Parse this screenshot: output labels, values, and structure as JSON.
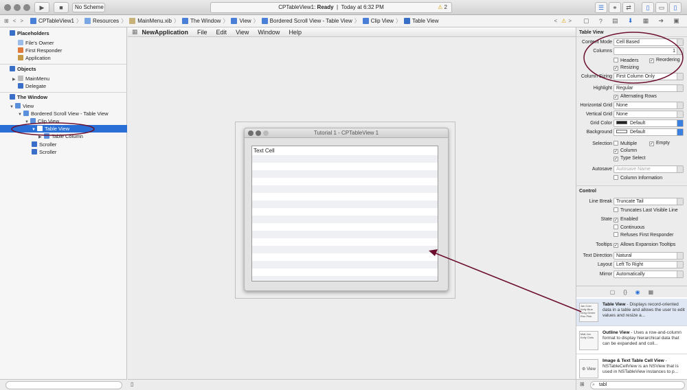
{
  "window": {
    "scheme": "No Scheme"
  },
  "activity": {
    "project": "CPTableView1",
    "state": "Ready",
    "time": "Today at 6:32 PM",
    "warnings": "2"
  },
  "jumpbar": {
    "crumbs": [
      "CPTableView1",
      "Resources",
      "MainMenu.xib",
      "The Window",
      "View",
      "Bordered Scroll View - Table View",
      "Clip View",
      "Table View"
    ]
  },
  "navigator": {
    "placeholders": "Placeholders",
    "files_owner": "File's Owner",
    "first_responder": "First Responder",
    "application": "Application",
    "objects": "Objects",
    "main_menu": "MainMenu",
    "delegate": "Delegate",
    "the_window": "The Window",
    "view": "View",
    "bordered_scroll": "Bordered Scroll View - Table View",
    "clip_view": "Clip View",
    "table_view": "Table View",
    "table_column": "Table Column",
    "scroller1": "Scroller",
    "scroller2": "Scroller"
  },
  "menubar": {
    "app": "NewApplication",
    "file": "File",
    "edit": "Edit",
    "view": "View",
    "window": "Window",
    "help": "Help"
  },
  "designwin": {
    "title": "Tutorial 1 - CPTableView 1",
    "cell": "Text Cell"
  },
  "inspector": {
    "section_table": "Table View",
    "content_mode_label": "Content Mode",
    "content_mode": "Cell Based",
    "columns_label": "Columns",
    "columns": "1",
    "headers": "Headers",
    "reordering": "Reordering",
    "resizing": "Resizing",
    "column_sizing_label": "Column Sizing",
    "column_sizing": "First Column Only",
    "highlight_label": "Highlight",
    "highlight": "Regular",
    "alternating": "Alternating Rows",
    "hgrid_label": "Horizontal Grid",
    "hgrid": "None",
    "vgrid_label": "Vertical Grid",
    "vgrid": "None",
    "grid_color_label": "Grid Color",
    "grid_color": "Default",
    "background_label": "Background",
    "background": "Default",
    "selection_label": "Selection",
    "multiple": "Multiple",
    "empty": "Empty",
    "column": "Column",
    "type_select": "Type Select",
    "autosave_label": "Autosave",
    "autosave_placeholder": "Autosave Name",
    "column_info": "Column Information",
    "section_control": "Control",
    "line_break_label": "Line Break",
    "line_break": "Truncate Tail",
    "truncates": "Truncates Last Visible Line",
    "state_label": "State",
    "enabled": "Enabled",
    "continuous": "Continuous",
    "refuses": "Refuses First Responder",
    "tooltips_label": "Tooltips",
    "tooltips": "Allows Expansion Tooltips",
    "text_dir_label": "Text Direction",
    "text_dir": "Natural",
    "layout_label": "Layout",
    "layout": "Left To Right",
    "mirror_label": "Mirror",
    "mirror": "Automatically"
  },
  "library": {
    "items": [
      {
        "title": "Table View",
        "desc": " - Displays record-oriented data in a table and allows the user to edit values and resize a...",
        "thumb": "Jan Crev Kelly Blue Greg Green Ron Pink"
      },
      {
        "title": "Outline View",
        "desc": " - Uses a row-and-column format to display hierarchical data that can be expanded and coll...",
        "thumb": "Mail Jon Kelly Chris"
      },
      {
        "title": "Image & Text Table Cell View",
        "desc": " - NSTableCellView is an NSView that is used in NSTableView instances to p...",
        "thumb": "View"
      }
    ],
    "search": "tabl"
  },
  "annotation_color": "#6b0f2c"
}
